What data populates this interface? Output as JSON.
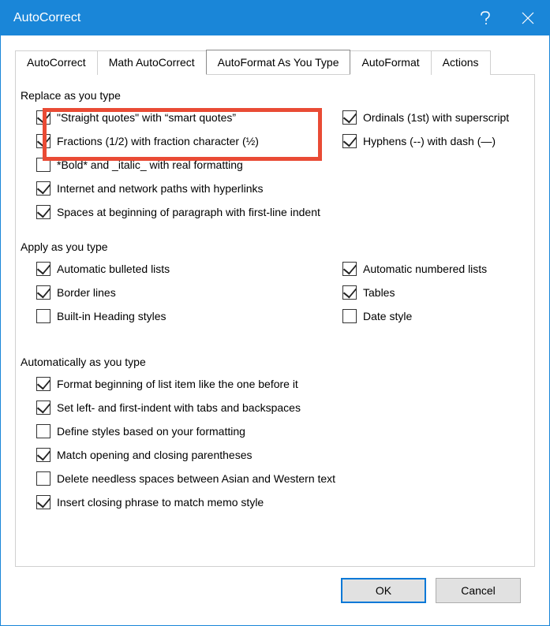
{
  "title": "AutoCorrect",
  "tabs": {
    "autocorrect": "AutoCorrect",
    "math": "Math AutoCorrect",
    "asyoutype": "AutoFormat As You Type",
    "autoformat": "AutoFormat",
    "actions": "Actions"
  },
  "sections": {
    "replace": "Replace as you type",
    "apply": "Apply as you type",
    "auto": "Automatically as you type"
  },
  "replace": {
    "straight": "\"Straight quotes\" with “smart quotes”",
    "fractions": "Fractions (1/2) with fraction character (½)",
    "bold": "*Bold* and _italic_ with real formatting",
    "internet": "Internet and network paths with hyperlinks",
    "spaces": "Spaces at beginning of paragraph with first-line indent",
    "ordinals": "Ordinals (1st) with superscript",
    "hyphens": "Hyphens (--) with dash (—)"
  },
  "apply": {
    "bulleted": "Automatic bulleted lists",
    "border": "Border lines",
    "heading": "Built-in Heading styles",
    "numbered": "Automatic numbered lists",
    "tables": "Tables",
    "date": "Date style"
  },
  "auto": {
    "format_begin": "Format beginning of list item like the one before it",
    "set_indent": "Set left- and first-indent with tabs and backspaces",
    "define_styles": "Define styles based on your formatting",
    "match_paren": "Match opening and closing parentheses",
    "delete_spaces": "Delete needless spaces between Asian and Western text",
    "insert_closing": "Insert closing phrase to match memo style"
  },
  "buttons": {
    "ok": "OK",
    "cancel": "Cancel"
  }
}
